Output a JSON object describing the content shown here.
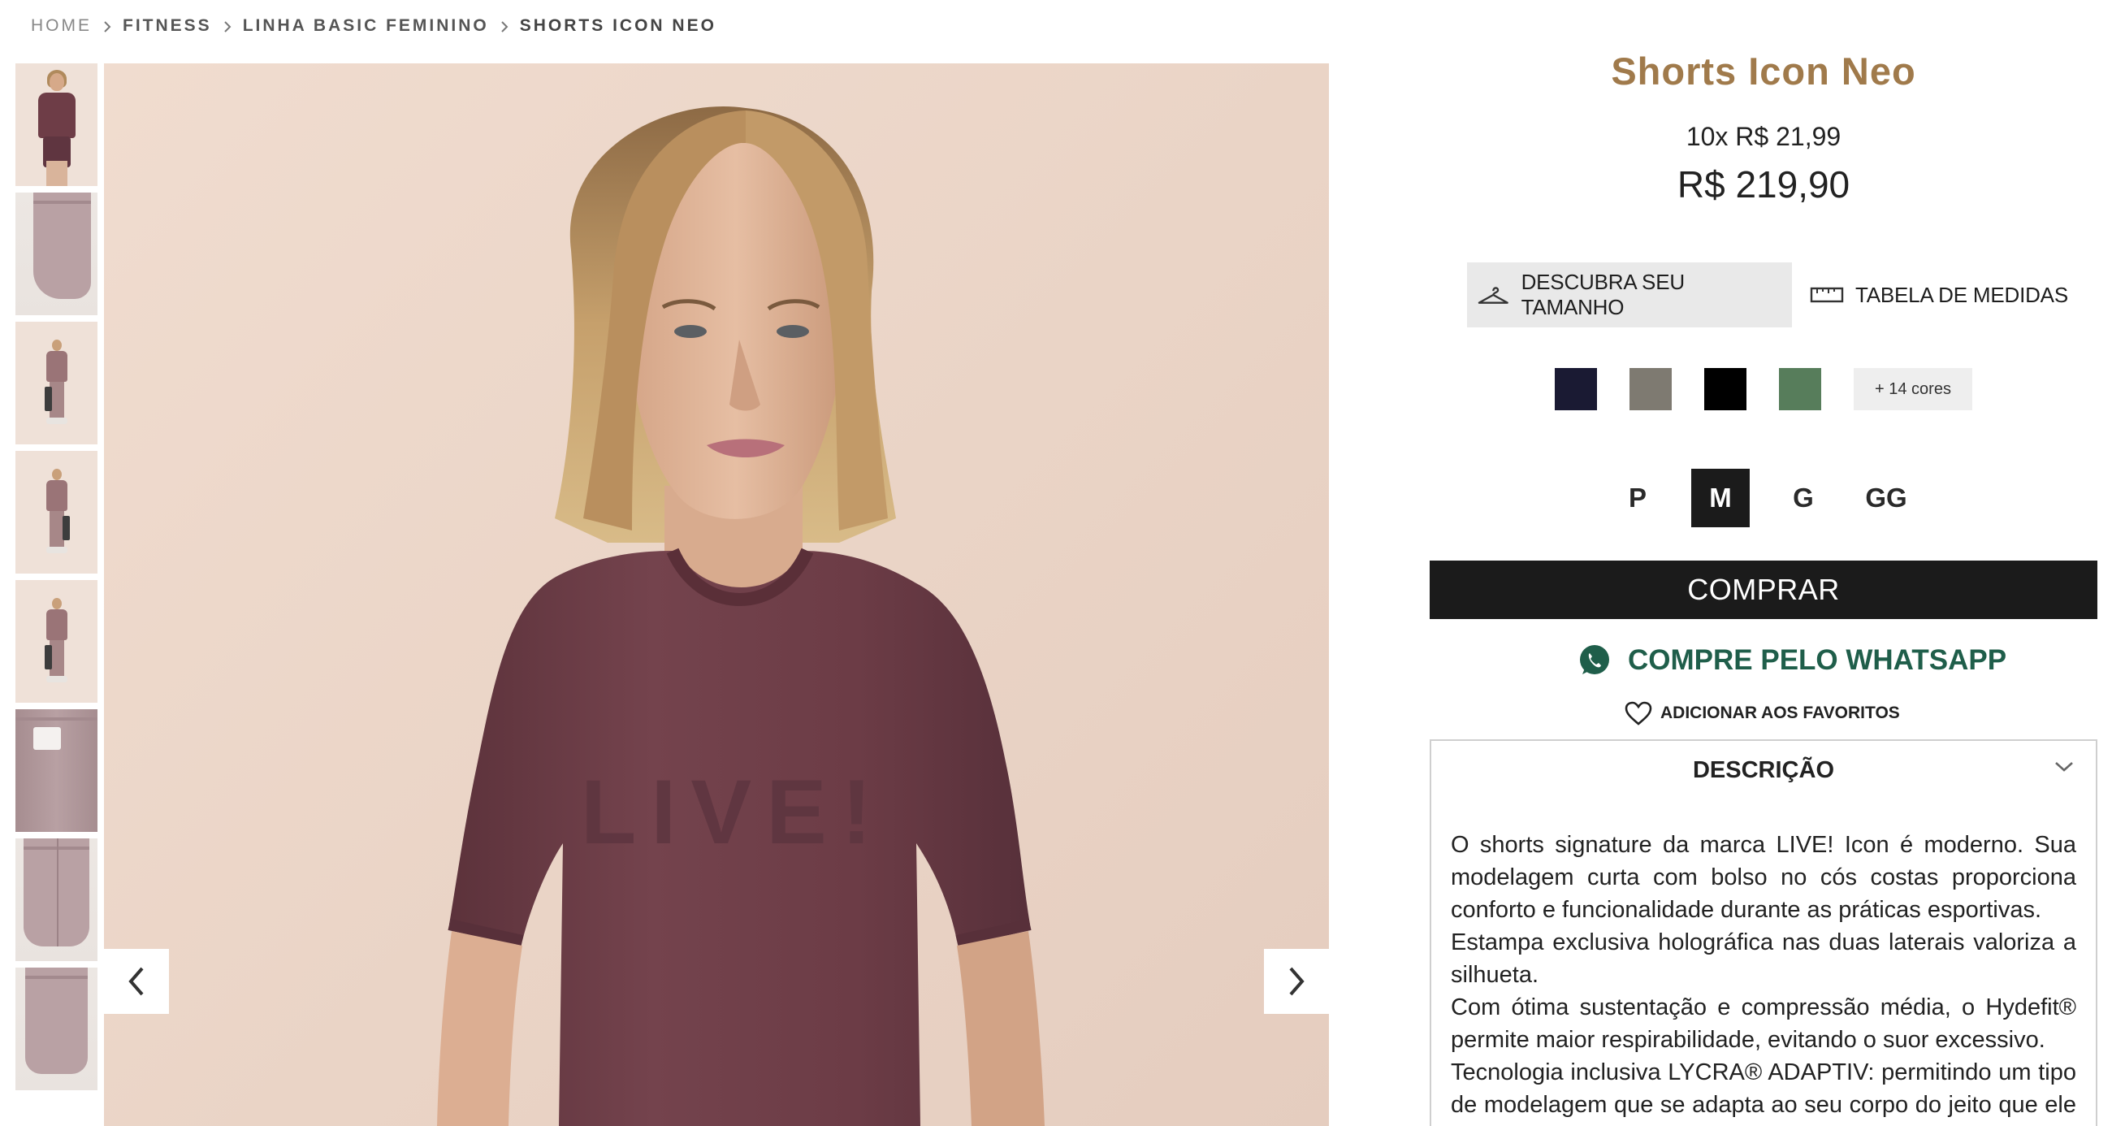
{
  "breadcrumb": {
    "home": "HOME",
    "level1": "FITNESS",
    "level2": "LINHA BASIC FEMININO",
    "current": "SHORTS ICON NEO"
  },
  "gallery": {
    "thumbnails": [
      "thumb-model-front",
      "thumb-shorts-side",
      "thumb-model-full-1",
      "thumb-model-full-2",
      "thumb-model-full-3",
      "thumb-shorts-pocket",
      "thumb-shorts-back",
      "thumb-shorts-front"
    ],
    "shirt_print": "LIVE!",
    "prev_icon": "chevron-left-icon",
    "next_icon": "chevron-right-icon"
  },
  "product": {
    "title": "Shorts Icon Neo",
    "installments": "10x R$ 21,99",
    "price": "R$ 219,90",
    "find_size_label": "DESCUBRA SEU TAMANHO",
    "size_table_label": "TABELA DE MEDIDAS",
    "colors": [
      "#1a1a33",
      "#7e7a71",
      "#000000",
      "#577d5b"
    ],
    "more_colors_label": "+ 14 cores",
    "sizes": [
      "P",
      "M",
      "G",
      "GG"
    ],
    "selected_size": "M",
    "buy_label": "COMPRAR",
    "whatsapp_label": "COMPRE PELO WHATSAPP",
    "favorites_label": "ADICIONAR AOS FAVORITOS",
    "description_title": "DESCRIÇÃO",
    "description_paragraphs": [
      "O shorts signature da marca LIVE! Icon é moderno. Sua modelagem curta com bolso no cós costas proporciona conforto e funcionalidade durante as práticas esportivas.",
      "Estampa exclusiva holográfica nas duas laterais valoriza a silhueta.",
      "Com ótima sustentação e compressão média, o Hydefit® permite maior respirabilidade, evitando o suor excessivo.",
      "Tecnologia inclusiva LYCRA® ADAPTIV: permitindo um tipo de modelagem que se adapta ao seu corpo do jeito que ele é."
    ]
  },
  "colors": {
    "title_gold": "#a07a4b",
    "buy_bg": "#1b1b1b",
    "whatsapp_green": "#1f5e4a",
    "shirt": "#6f3f48"
  }
}
